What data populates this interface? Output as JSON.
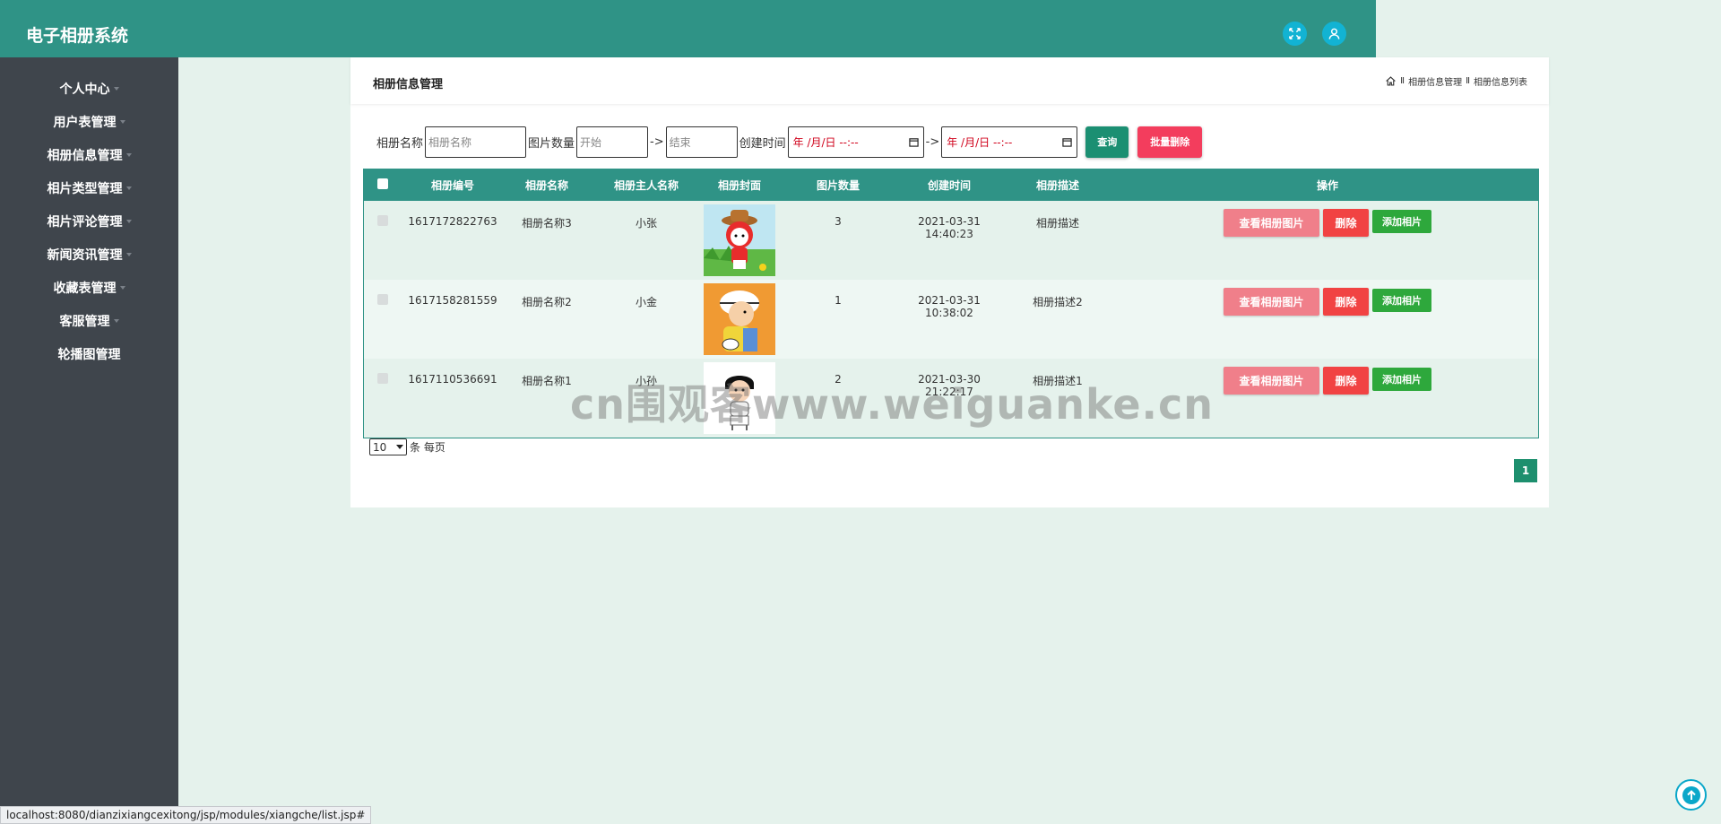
{
  "app": {
    "title": "电子相册系统"
  },
  "header_icons": [
    "fullscreen-icon",
    "user-icon"
  ],
  "sidebar": {
    "items": [
      {
        "label": "个人中心"
      },
      {
        "label": "用户表管理"
      },
      {
        "label": "相册信息管理"
      },
      {
        "label": "相片类型管理"
      },
      {
        "label": "相片评论管理"
      },
      {
        "label": "新闻资讯管理"
      },
      {
        "label": "收藏表管理"
      },
      {
        "label": "客服管理"
      },
      {
        "label": "轮播图管理"
      }
    ]
  },
  "panel": {
    "title": "相册信息管理",
    "breadcrumb": {
      "sep": "Ⅱ",
      "level1": "相册信息管理",
      "level2": "相册信息列表"
    }
  },
  "filters": {
    "name_label": "相册名称",
    "name_placeholder": "相册名称",
    "count_label": "图片数量",
    "count_start_placeholder": "开始",
    "count_end_placeholder": "结束",
    "range_sep": "->",
    "time_label": "创建时间",
    "date_placeholder": "年 /月/日 --:--",
    "query_label": "查询",
    "bulk_delete_label": "批量删除"
  },
  "table": {
    "columns": [
      "相册编号",
      "相册名称",
      "相册主人名称",
      "相册封面",
      "图片数量",
      "创建时间",
      "相册描述",
      "操作"
    ],
    "rows": [
      {
        "id": "1617172822763",
        "name": "相册名称3",
        "owner": "小张",
        "count": "3",
        "created": "2021-03-31 14:40:23",
        "desc": "相册描述"
      },
      {
        "id": "1617158281559",
        "name": "相册名称2",
        "owner": "小金",
        "count": "1",
        "created": "2021-03-31 10:38:02",
        "desc": "相册描述2"
      },
      {
        "id": "1617110536691",
        "name": "相册名称1",
        "owner": "小孙",
        "count": "2",
        "created": "2021-03-30 21:22:17",
        "desc": "相册描述1"
      }
    ],
    "actions": {
      "view": "查看相册图片",
      "delete": "删除",
      "add": "添加相片"
    }
  },
  "pagination": {
    "page_size": "10",
    "page_size_suffix": "条 每页",
    "current_page": "1"
  },
  "watermark": "cn围观客www.weiguanke.cn",
  "status_url": "localhost:8080/dianzixiangcexitong/jsp/modules/xiangche/list.jsp#",
  "colors": {
    "header": "#2f9386",
    "sidebar": "#3f454c",
    "background": "#e5f2ec",
    "danger": "#f14343",
    "success": "#2ea83c"
  }
}
